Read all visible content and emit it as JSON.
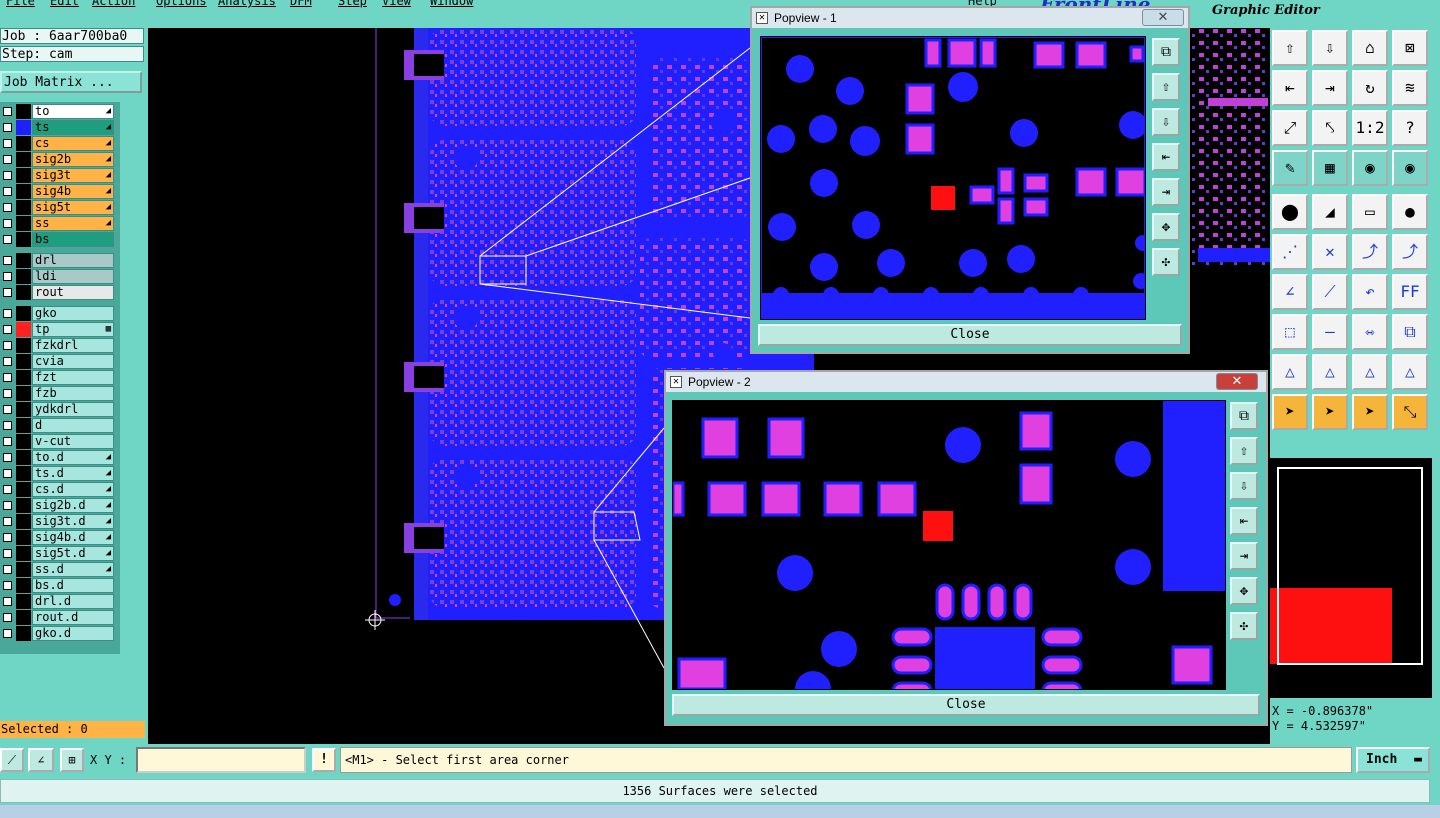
{
  "menu": {
    "items": [
      "File",
      "Edit",
      "Action",
      "Options",
      "Analysis",
      "DFM",
      "Step",
      "View",
      "Window"
    ],
    "help": "Help"
  },
  "app": {
    "title": "Graphic Editor",
    "brand_partial": "FrontLine"
  },
  "job": {
    "job_label": "Job : 6aar700ba0",
    "step_label": "Step: cam",
    "matrix_button": "Job Matrix ..."
  },
  "layers": {
    "board": [
      {
        "name": "to",
        "color": "#ffffff",
        "swatch": "#000000",
        "mark": "◢"
      },
      {
        "name": "ts",
        "color": "#1e9e7e",
        "swatch": "#2020ff",
        "mark": "◢"
      },
      {
        "name": "cs",
        "color": "#ffb347",
        "swatch": "#000000",
        "mark": "◢"
      },
      {
        "name": "sig2b",
        "color": "#ffb347",
        "swatch": "#000000",
        "mark": "◢"
      },
      {
        "name": "sig3t",
        "color": "#ffb347",
        "swatch": "#000000",
        "mark": "◢"
      },
      {
        "name": "sig4b",
        "color": "#ffb347",
        "swatch": "#000000",
        "mark": "◢"
      },
      {
        "name": "sig5t",
        "color": "#ffb347",
        "swatch": "#000000",
        "mark": "◢"
      },
      {
        "name": "ss",
        "color": "#ffb347",
        "swatch": "#000000",
        "mark": "◢"
      },
      {
        "name": "bs",
        "color": "#1e9e7e",
        "swatch": "#000000",
        "mark": ""
      }
    ],
    "drill": [
      {
        "name": "drl",
        "color": "#a9c9c9",
        "swatch": "#000000",
        "mark": ""
      },
      {
        "name": "ldi",
        "color": "#a9c9c9",
        "swatch": "#000000",
        "mark": ""
      },
      {
        "name": "rout",
        "color": "#e8e8e8",
        "swatch": "#000000",
        "mark": ""
      }
    ],
    "misc": [
      {
        "name": "gko",
        "color": "#a6e6de",
        "swatch": "#000000",
        "mark": ""
      },
      {
        "name": "tp",
        "color": "#a6e6de",
        "swatch": "#ff2020",
        "mark": "▦"
      },
      {
        "name": "fzkdrl",
        "color": "#a6e6de",
        "swatch": "#000000",
        "mark": ""
      },
      {
        "name": "cvia",
        "color": "#a6e6de",
        "swatch": "#000000",
        "mark": ""
      },
      {
        "name": "fzt",
        "color": "#a6e6de",
        "swatch": "#000000",
        "mark": ""
      },
      {
        "name": "fzb",
        "color": "#a6e6de",
        "swatch": "#000000",
        "mark": ""
      },
      {
        "name": "ydkdrl",
        "color": "#a6e6de",
        "swatch": "#000000",
        "mark": ""
      },
      {
        "name": "d",
        "color": "#a6e6de",
        "swatch": "#000000",
        "mark": ""
      },
      {
        "name": "v-cut",
        "color": "#a6e6de",
        "swatch": "#000000",
        "mark": ""
      },
      {
        "name": "to.d",
        "color": "#a6e6de",
        "swatch": "#000000",
        "mark": "◢"
      },
      {
        "name": "ts.d",
        "color": "#a6e6de",
        "swatch": "#000000",
        "mark": "◢"
      },
      {
        "name": "cs.d",
        "color": "#a6e6de",
        "swatch": "#000000",
        "mark": "◢"
      },
      {
        "name": "sig2b.d",
        "color": "#a6e6de",
        "swatch": "#000000",
        "mark": "◢"
      },
      {
        "name": "sig3t.d",
        "color": "#a6e6de",
        "swatch": "#000000",
        "mark": "◢"
      },
      {
        "name": "sig4b.d",
        "color": "#a6e6de",
        "swatch": "#000000",
        "mark": "◢"
      },
      {
        "name": "sig5t.d",
        "color": "#a6e6de",
        "swatch": "#000000",
        "mark": "◢"
      },
      {
        "name": "ss.d",
        "color": "#a6e6de",
        "swatch": "#000000",
        "mark": "◢"
      },
      {
        "name": "bs.d",
        "color": "#a6e6de",
        "swatch": "#000000",
        "mark": ""
      },
      {
        "name": "drl.d",
        "color": "#a6e6de",
        "swatch": "#000000",
        "mark": ""
      },
      {
        "name": "rout.d",
        "color": "#a6e6de",
        "swatch": "#000000",
        "mark": ""
      },
      {
        "name": "gko.d",
        "color": "#a6e6de",
        "swatch": "#000000",
        "mark": ""
      }
    ]
  },
  "selection": {
    "label": "Selected : 0"
  },
  "popview1": {
    "title": "Popview - 1",
    "close_label": "Close"
  },
  "popview2": {
    "title": "Popview - 2",
    "close_label": "Close"
  },
  "coords": {
    "x": "X = -0.896378\"",
    "y": "Y = 4.532597\""
  },
  "command": {
    "xy_label": "X Y :",
    "xy_value": "",
    "prompt": "<M1> - Select first area corner",
    "unit": "Inch"
  },
  "status": {
    "message": "1356 Surfaces were selected"
  },
  "colors": {
    "pad": "#2020ff",
    "smd": "#e040e0",
    "selected": "#ff1010",
    "panel": "#6fd6c6"
  }
}
